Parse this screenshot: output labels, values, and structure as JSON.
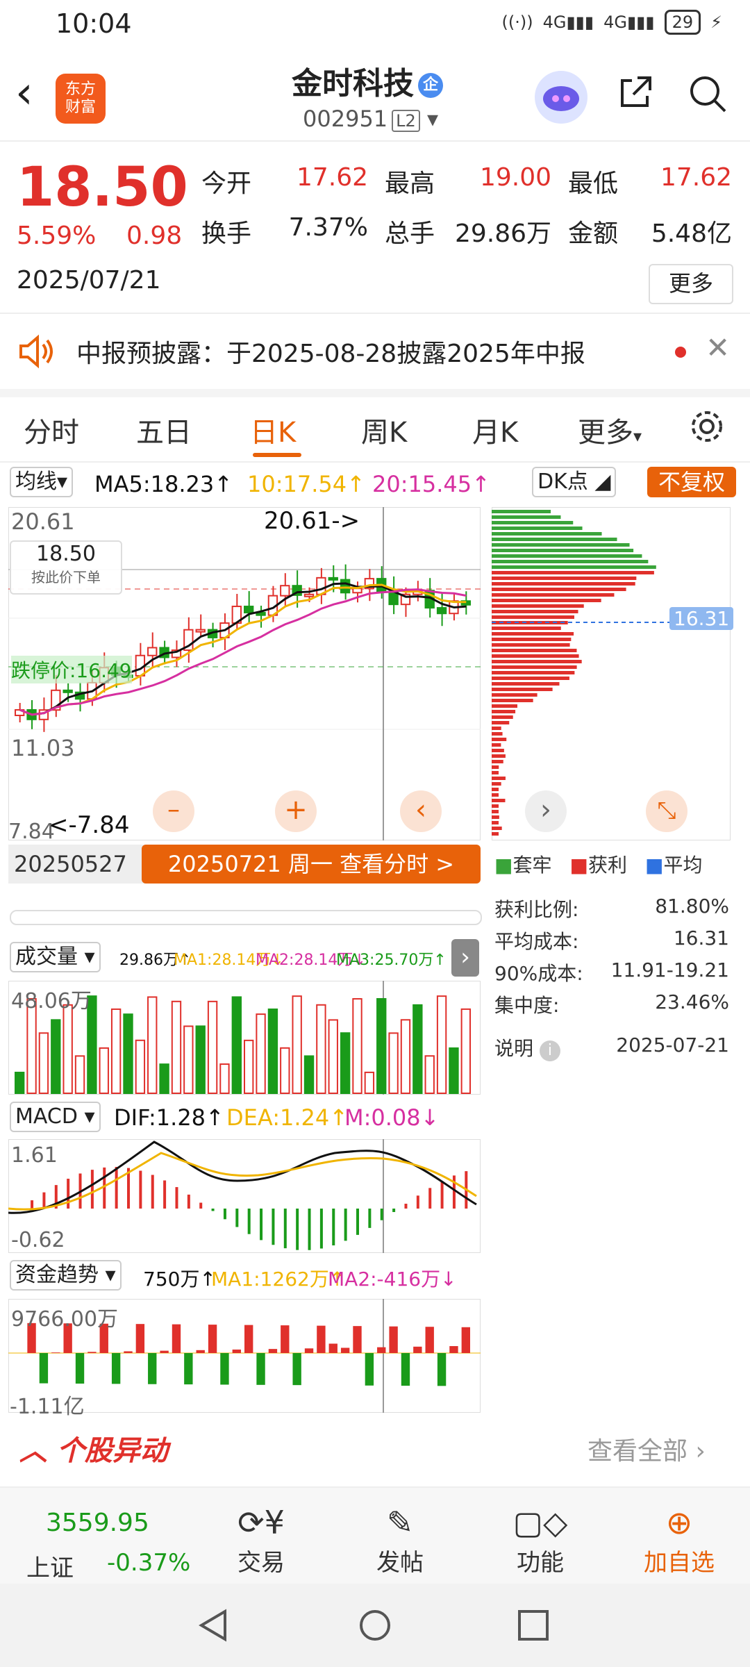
{
  "status": {
    "time": "10:04",
    "net1": "4G",
    "net2": "4G",
    "battery": "29"
  },
  "header": {
    "logo_line1": "东方",
    "logo_line2": "财富",
    "title": "金时科技",
    "badge": "企",
    "code": "002951",
    "level": "L2"
  },
  "quote": {
    "price": "18.50",
    "pct": "5.59%",
    "change": "0.98",
    "date": "2025/07/21",
    "open_label": "今开",
    "open": "17.62",
    "high_label": "最高",
    "high": "19.00",
    "low_label": "最低",
    "low": "17.62",
    "turnover_label": "换手",
    "turnover": "7.37%",
    "volume_label": "总手",
    "volume": "29.86万",
    "amount_label": "金额",
    "amount": "5.48亿",
    "more_label": "更多"
  },
  "notice": {
    "text": "中报预披露：于2025-08-28披露2025年中报"
  },
  "tabs": [
    "分时",
    "五日",
    "日K",
    "周K",
    "月K",
    "更多"
  ],
  "active_tab": "日K",
  "kline": {
    "ma_select": "均线",
    "ma5": "MA5:18.23↑",
    "ma10": "10:17.54↑",
    "ma20": "20:15.45↑",
    "dk": "DK点",
    "fq": "不复权",
    "max_label": "20.61",
    "max_arrow": "20.61->",
    "mid_label": "11.03",
    "min_label": "7.84",
    "min_arrow": "<-7.84",
    "price_tip": "18.50",
    "price_tip_sub": "按此价下单",
    "limit_label": "跌停价:16.49",
    "start_date": "20250527",
    "cta": "20250721 周一 查看分时 >",
    "colors": {
      "up": "#e0302b",
      "down": "#1a9b1a",
      "ma5": "#111111",
      "ma10": "#f0b400",
      "ma20": "#d62fa0"
    }
  },
  "chip": {
    "avg_label": "16.31",
    "legend": [
      "套牢",
      "获利",
      "平均"
    ],
    "rows": [
      {
        "k": "获利比例:",
        "v": "81.80%"
      },
      {
        "k": "平均成本:",
        "v": "16.31"
      },
      {
        "k": "90%成本:",
        "v": "11.91-19.21"
      },
      {
        "k": "集中度:",
        "v": "23.46%"
      }
    ],
    "note": "说明",
    "note_date": "2025-07-21"
  },
  "volume": {
    "select": "成交量",
    "val": "29.86万↑",
    "ma1": "MA1:28.14万↓",
    "ma2": "MA2:28.14万↓",
    "ma3": "MA3:25.70万↑",
    "top": "48.06万"
  },
  "macd": {
    "select": "MACD",
    "dif": "DIF:1.28↑",
    "dea": "DEA:1.24↑",
    "m": "M:0.08↓",
    "top": "1.61",
    "bottom": "-0.62"
  },
  "fund": {
    "select": "资金趋势",
    "val": "750万↑",
    "ma1": "MA1:1262万↑",
    "ma2": "MA2:-416万↓",
    "top": "9766.00万",
    "bottom": "-1.11亿"
  },
  "section": {
    "title": "个股异动",
    "link": "查看全部"
  },
  "bottom_nav": {
    "index_value": "3559.95",
    "index_name": "上证",
    "index_pct": "-0.37%",
    "items": [
      "交易",
      "发帖",
      "功能",
      "加自选"
    ]
  }
}
